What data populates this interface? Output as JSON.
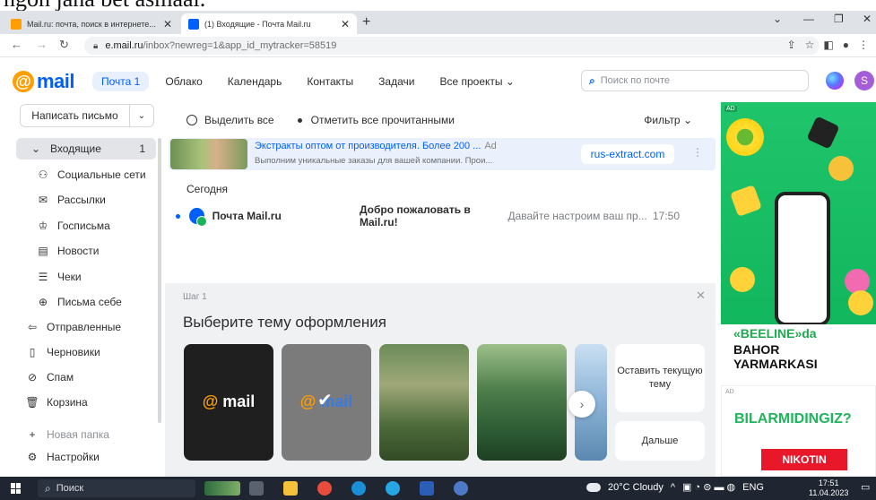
{
  "caption": "ngon jana bet asmaai.",
  "browser": {
    "tabs": [
      {
        "title": "Mail.ru: почта, поиск в интернете...",
        "active": false
      },
      {
        "title": "(1) Входящие - Почта Mail.ru",
        "active": true
      }
    ],
    "url_host": "e.mail.ru",
    "url_path": "/inbox?newreg=1&app_id_mytracker=58519"
  },
  "header": {
    "logo": "mail",
    "nav": [
      "Почта 1",
      "Облако",
      "Календарь",
      "Контакты",
      "Задачи",
      "Все проекты ⌄"
    ],
    "search_placeholder": "Поиск по почте",
    "avatar": "S"
  },
  "sidebar": {
    "compose": "Написать письмо",
    "folders": [
      {
        "label": "Входящие",
        "count": "1",
        "icon": "chevron-down-icon",
        "active": true
      },
      {
        "label": "Социальные сети",
        "icon": "social-icon",
        "sub": true
      },
      {
        "label": "Рассылки",
        "icon": "newsletter-icon",
        "sub": true
      },
      {
        "label": "Госписьма",
        "icon": "gov-icon",
        "sub": true
      },
      {
        "label": "Новости",
        "icon": "news-icon",
        "sub": true
      },
      {
        "label": "Чеки",
        "icon": "receipt-icon",
        "sub": true
      },
      {
        "label": "Письма себе",
        "icon": "self-icon",
        "sub": true
      },
      {
        "label": "Отправленные",
        "icon": "sent-icon"
      },
      {
        "label": "Черновики",
        "icon": "drafts-icon"
      },
      {
        "label": "Спам",
        "icon": "spam-icon"
      },
      {
        "label": "Корзина",
        "icon": "trash-icon"
      },
      {
        "label": "Новая папка",
        "icon": "plus-icon"
      },
      {
        "label": "Настройки",
        "icon": "settings-icon"
      }
    ]
  },
  "toolbar": {
    "select_all": "Выделить все",
    "mark_read": "Отметить все прочитанными",
    "filter": "Фильтр ⌄"
  },
  "ad_row": {
    "title": "Экстракты оптом от производителя. Более 200 ...",
    "ad_label": "Ad",
    "text": "Выполним уникальные заказы для вашей компании. Прои...",
    "button": "rus-extract.com"
  },
  "today_label": "Сегодня",
  "message": {
    "from": "Почта Mail.ru",
    "subject": "Добро пожаловать в Mail.ru!",
    "snippet": "Давайте настроим ваш пр...",
    "time": "17:50"
  },
  "theme": {
    "step": "Шаг 1",
    "title": "Выберите тему оформления",
    "card_logo": "mail",
    "keep": "Оставить текущую тему",
    "next": "Дальше"
  },
  "ads": {
    "tag": "AD",
    "banner_line1": "«BEELINE»da",
    "banner_line2": "BAHOR",
    "banner_line3": "YARMARKASI",
    "ad2_head": "BILARMIDINGIZ?",
    "ad2_button": "NIKOTIN"
  },
  "taskbar": {
    "search": "Поиск",
    "weather": "20°C Cloudy",
    "lang": "ENG",
    "time": "17:51",
    "date": "11.04.2023"
  }
}
